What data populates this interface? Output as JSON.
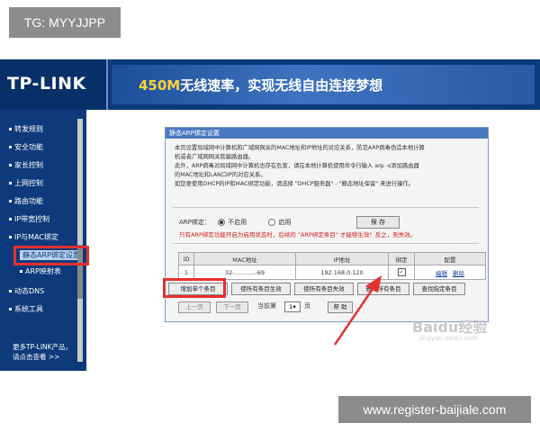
{
  "overlay": {
    "tg": "TG: MYYJJPP",
    "site": "www.register-baijiale.com"
  },
  "header": {
    "logo": "TP-LINK",
    "slogan_highlight": "450M",
    "slogan_rest": "无线速率，实现无线自由连接梦想"
  },
  "sidebar": {
    "items": [
      "转发规则",
      "安全功能",
      "家长控制",
      "上网控制",
      "路由功能",
      "IP带宽控制",
      "IP与MAC绑定",
      "静态ARP绑定设置",
      "ARP映射表",
      "动态DNS",
      "系统工具"
    ],
    "more_line1": "更多TP-LINK产品，",
    "more_line2": "请点击查看 >>"
  },
  "panel": {
    "title": "静态ARP绑定设置",
    "desc": [
      "本页设置局域网中计算机和广域网网关的MAC地址和IP地址的对应关系，防范ARP病毒伪造本地计算",
      "机或者广域网网关欺骗路由器。",
      "此外，ARP病毒对局域网中计算机也存在危害，请在本地计算机使用命令行输入 arp -s添加路由器",
      "的MAC地址和LAN口IP的对应关系。",
      "如您要使用DHCP的IP和MAC绑定功能，请选择 \"DHCP服务器\" - \"静态地址保留\" 来进行操作。"
    ],
    "arp_label": "ARP绑定：",
    "option_off": "不启用",
    "option_on": "启用",
    "save": "保 存",
    "warning": "只有ARP绑定功能开启为启用状态时，后续的 \"ARP绑定条目\" 才能够生效！反之，则失效。"
  },
  "table": {
    "headers": [
      "ID",
      "MAC地址",
      "IP地址",
      "绑定",
      "配置"
    ],
    "rows": [
      {
        "id": "1",
        "mac": "32-...........-69",
        "ip": "192.168.0.120",
        "edit": "编辑",
        "delete": "删除"
      }
    ]
  },
  "actions": {
    "add": "增加单个条目",
    "enable_all": "使所有条目生效",
    "disable_all": "使所有条目失效",
    "delete_all": "删除所有条目",
    "find": "查找指定条目"
  },
  "pager": {
    "prev": "上一页",
    "next": "下一页",
    "current_label": "当前第",
    "current_value": "1",
    "page_suffix": "页",
    "help": "帮 助"
  },
  "watermark": {
    "main": "Baidu经验",
    "sub": "jingyan.baidu.com"
  },
  "colors": {
    "brand_blue": "#0c3a7a",
    "highlight_red": "#e53030",
    "warning_red": "#d12020"
  }
}
